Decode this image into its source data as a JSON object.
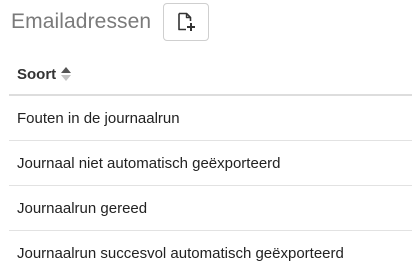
{
  "header": {
    "title": "Emailadressen",
    "add_icon": "new-document-icon"
  },
  "table": {
    "column_header": "Soort",
    "sort_icon": "sort-asc-icon",
    "rows": [
      "Fouten in de journaalrun",
      "Journaal niet automatisch geëxporteerd",
      "Journaalrun gereed",
      "Journaalrun succesvol automatisch geëxporteerd"
    ]
  }
}
